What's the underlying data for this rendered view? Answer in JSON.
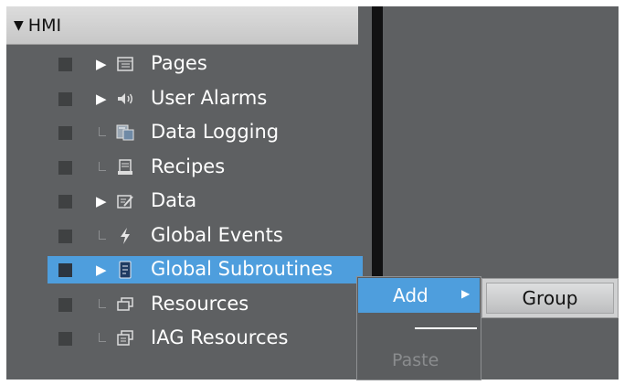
{
  "tree": {
    "root": {
      "label": "HMI",
      "caret": "▼"
    },
    "items": [
      {
        "label": "Pages",
        "expandable": true,
        "icon": "pages-icon",
        "selected": false
      },
      {
        "label": "User Alarms",
        "expandable": true,
        "icon": "speaker-icon",
        "selected": false
      },
      {
        "label": "Data Logging",
        "expandable": false,
        "icon": "data-logging-icon",
        "selected": false
      },
      {
        "label": "Recipes",
        "expandable": false,
        "icon": "recipes-icon",
        "selected": false
      },
      {
        "label": "Data",
        "expandable": true,
        "icon": "data-icon",
        "selected": false
      },
      {
        "label": "Global Events",
        "expandable": false,
        "icon": "lightning-icon",
        "selected": false
      },
      {
        "label": "Global Subroutines",
        "expandable": true,
        "icon": "script-icon",
        "selected": true
      },
      {
        "label": "Resources",
        "expandable": false,
        "icon": "resources-icon",
        "selected": false
      },
      {
        "label": "IAG Resources",
        "expandable": false,
        "icon": "iag-resources-icon",
        "selected": false
      }
    ],
    "expander_glyph": "▶"
  },
  "context_menu": {
    "add_label": "Add",
    "add_arrow": "▶",
    "paste_label": "Paste"
  },
  "submenu": {
    "group_label": "Group"
  },
  "colors": {
    "panel": "#5e6062",
    "splitter": "#111112",
    "selection": "#4e9edd",
    "header": "#d3d3d3"
  }
}
